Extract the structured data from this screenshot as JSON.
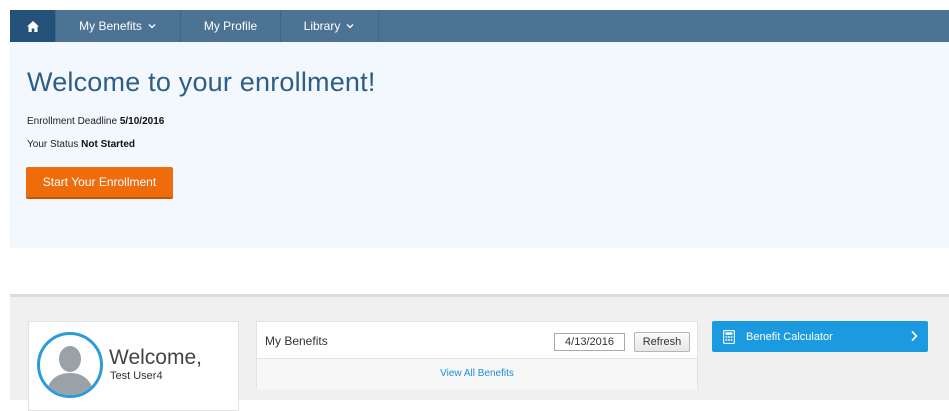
{
  "nav": {
    "home_icon": "home-icon",
    "items": [
      {
        "label": "My Benefits",
        "has_dropdown": true
      },
      {
        "label": "My Profile",
        "has_dropdown": false
      },
      {
        "label": "Library",
        "has_dropdown": true
      }
    ]
  },
  "hero": {
    "title": "Welcome to your enrollment!",
    "deadline_label": "Enrollment Deadline",
    "deadline_value": "5/10/2016",
    "status_label": "Your Status",
    "status_value": "Not Started",
    "start_button": "Start Your Enrollment"
  },
  "welcome_card": {
    "greeting": "Welcome,",
    "user_name": "Test User4"
  },
  "benefits_card": {
    "title": "My Benefits",
    "date": "4/13/2016",
    "refresh_label": "Refresh",
    "view_all_label": "View All Benefits"
  },
  "calculator": {
    "label": "Benefit Calculator"
  },
  "colors": {
    "nav_bg": "#4d7394",
    "nav_home_bg": "#24517a",
    "hero_bg": "#f2f8fd",
    "title_color": "#2f5d86",
    "accent_orange": "#ef6c0d",
    "accent_blue": "#1c9ae0",
    "link_blue": "#1a8fd6"
  }
}
